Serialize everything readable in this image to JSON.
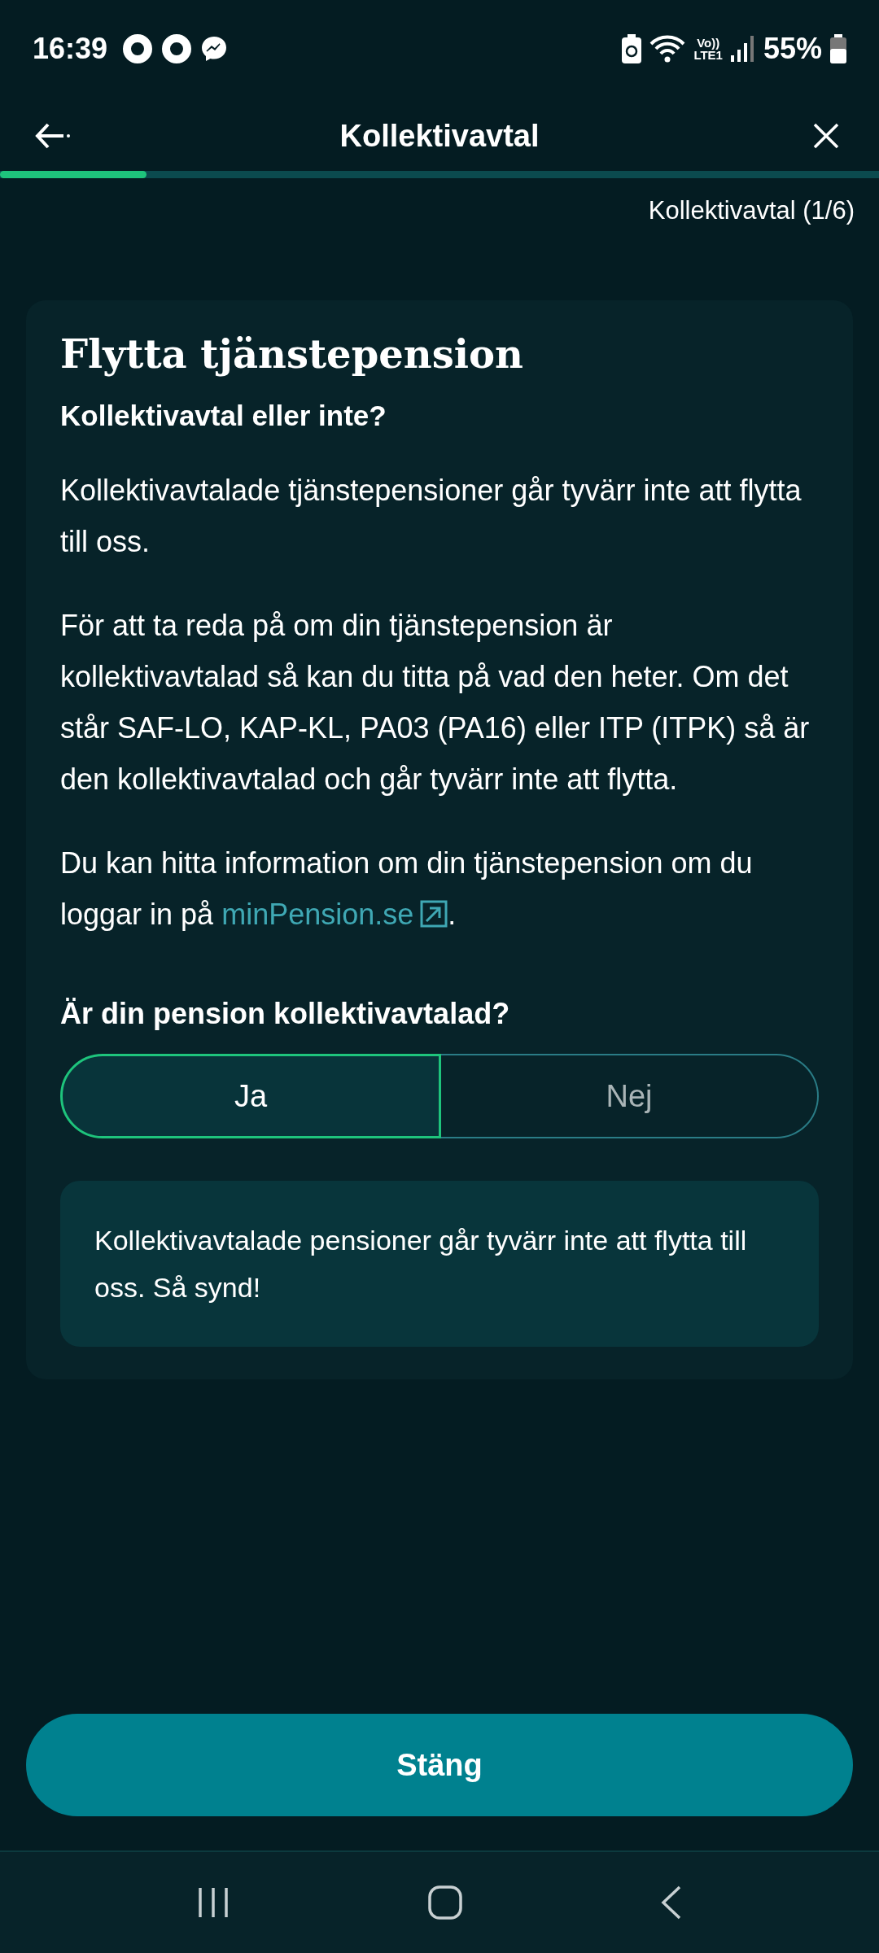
{
  "status_bar": {
    "time": "16:39",
    "volte": "Vo))",
    "network": "LTE1",
    "battery": "55%"
  },
  "header": {
    "title": "Kollektivavtal"
  },
  "progress": {
    "level": 0.167
  },
  "step_label": "Kollektivavtal (1/6)",
  "card": {
    "title": "Flytta tjänstepension",
    "subtitle": "Kollektivavtal eller inte?",
    "paragraphs": [
      "Kollektivavtalade tjänstepensioner går tyvärr inte att flytta till oss.",
      "För att ta reda på om din tjänstepension är kollektivavtalad så kan du titta på vad den heter. Om det står SAF-LO, KAP-KL, PA03 (PA16) eller ITP (ITPK) så är den kollektivavtalad och går tyvärr inte att flytta."
    ],
    "link_paragraph": {
      "before": "Du kan hitta information om din tjänstepension om du loggar in på ",
      "link": "minPension.se",
      "after": "."
    },
    "question": "Är din pension kollektivavtalad?",
    "options": [
      {
        "label": "Ja",
        "selected": true
      },
      {
        "label": "Nej",
        "selected": false
      }
    ],
    "notice": "Kollektivavtalade pensioner går tyvärr inte att flytta till oss. Så synd!"
  },
  "close_button": "Stäng"
}
